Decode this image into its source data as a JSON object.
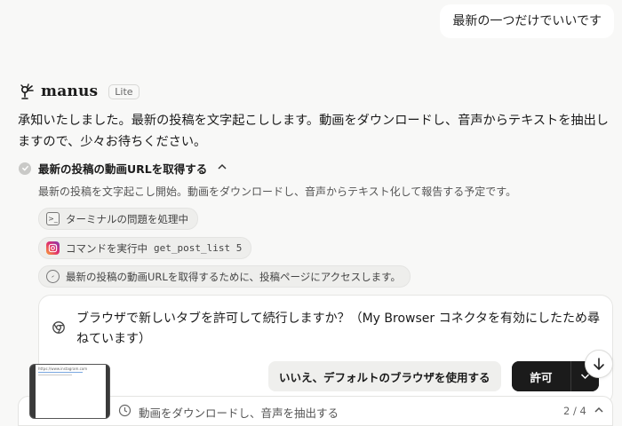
{
  "user_message": "最新の一つだけでいいです",
  "agent": {
    "name": "manus",
    "badge": "Lite",
    "message": "承知いたしました。最新の投稿を文字起こしします。動画をダウンロードし、音声からテキストを抽出しますので、少々お待ちください。"
  },
  "step": {
    "title": "最新の投稿の動画URLを取得する",
    "description": "最新の投稿を文字起こし開始。動画をダウンロードし、音声からテキスト化して報告する予定です。",
    "actions": [
      {
        "icon": "terminal-icon",
        "label": "ターミナルの問題を処理中"
      },
      {
        "icon": "instagram-icon",
        "label": "コマンドを実行中",
        "code": "get_post_list 5"
      },
      {
        "icon": "compass-icon",
        "label": "最新の投稿の動画URLを取得するために、投稿ページにアクセスします。"
      }
    ]
  },
  "permission": {
    "message": "ブラウザで新しいタブを許可して続行しますか？（My Browser コネクタを有効にしたため尋ねています）",
    "deny_label": "いいえ、デフォルトのブラウザを使用する",
    "allow_label": "許可"
  },
  "task_bar": {
    "current_task": "動画をダウンロードし、音声を抽出する",
    "progress": "2 / 4"
  },
  "colors": {
    "background": "#f8f8f7",
    "primary_button": "#1b1b1b",
    "secondary_button": "#efefed"
  }
}
